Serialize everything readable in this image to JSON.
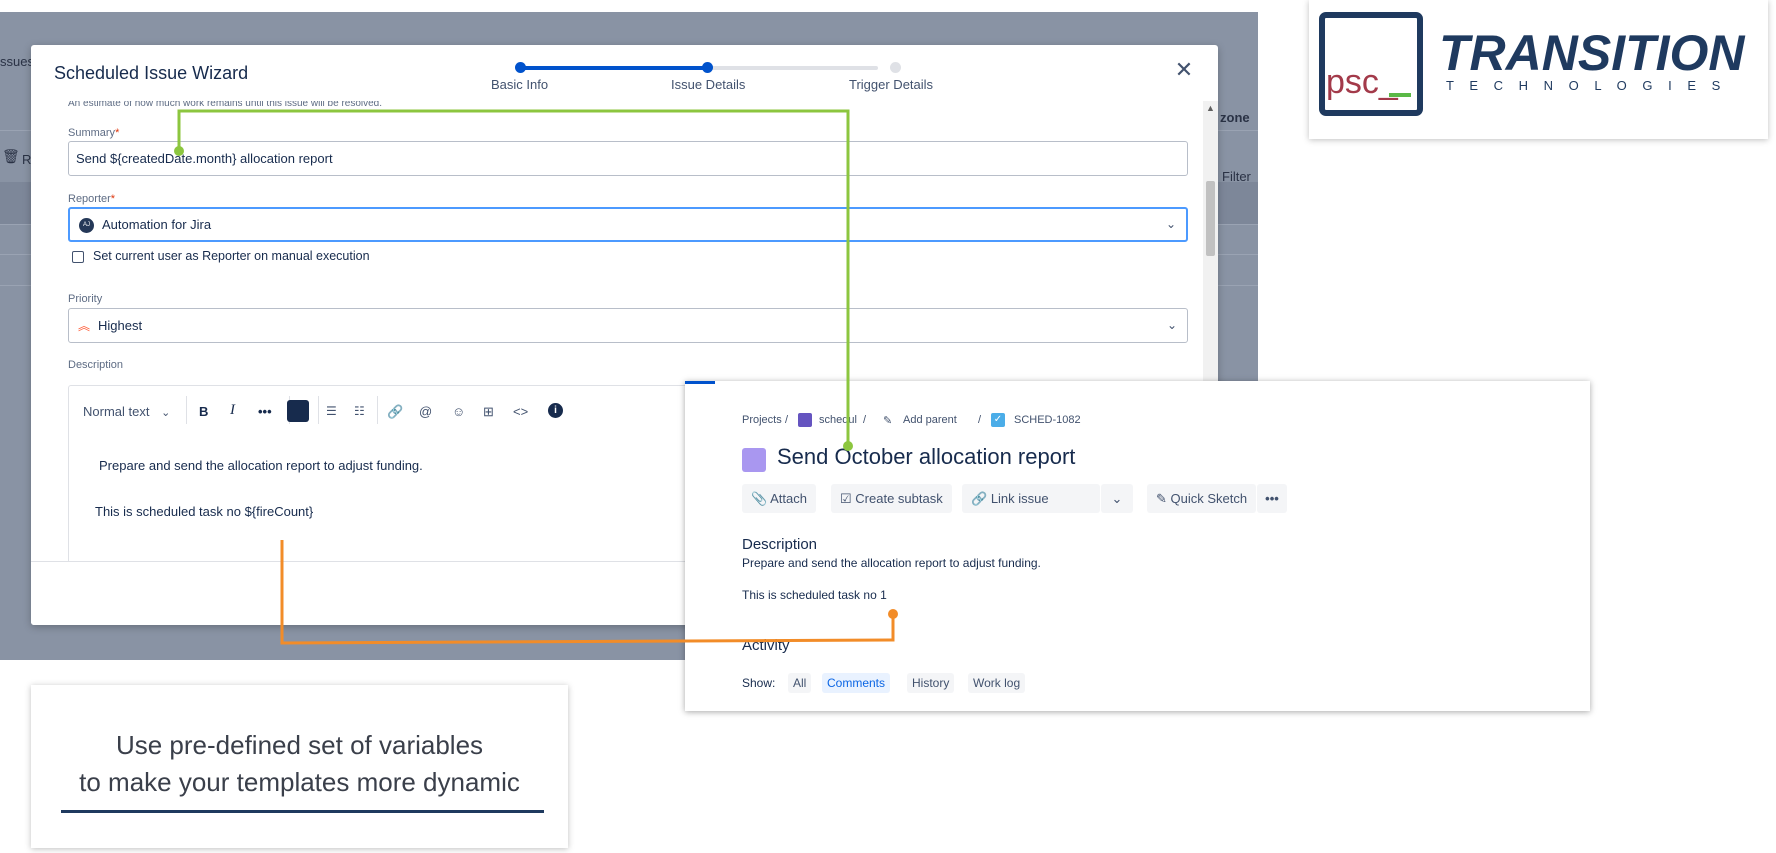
{
  "background": {
    "partial_issues": "ssues",
    "partial_zone": "zone",
    "partial_filter": "Filter",
    "partial_r": "R"
  },
  "wizard": {
    "title": "Scheduled Issue Wizard",
    "steps": [
      {
        "label": "Basic Info"
      },
      {
        "label": "Issue Details"
      },
      {
        "label": "Trigger Details"
      }
    ],
    "accent_color": "#0052cc",
    "truncated_hint": "An estimate of how much work remains until this issue will be resolved.",
    "summary": {
      "label": "Summary",
      "required": "*",
      "value": "Send ${createdDate.month} allocation report"
    },
    "reporter": {
      "label": "Reporter",
      "required": "*",
      "value": "Automation for Jira",
      "avatar": "AJ"
    },
    "reporter_checkbox": "Set current user as Reporter on manual execution",
    "priority": {
      "label": "Priority",
      "value": "Highest",
      "color": "#ff5630"
    },
    "description": {
      "label": "Description",
      "toolbar": {
        "text_style": "Normal text"
      },
      "line1": "Prepare and send the allocation report to adjust funding.",
      "line2": "This is scheduled task no ${fireCount}"
    }
  },
  "issue": {
    "breadcrumb": {
      "projects": "Projects",
      "project": "schedul",
      "add_parent": "Add parent",
      "key": "SCHED-1082"
    },
    "title": "Send October allocation report",
    "actions": {
      "attach": "Attach",
      "create_subtask": "Create subtask",
      "link_issue": "Link issue",
      "quick_sketch": "Quick Sketch"
    },
    "description_heading": "Description",
    "description_line1": "Prepare and send the allocation report to adjust funding.",
    "description_line2": "This is scheduled task no 1",
    "activity_heading": "Activity",
    "show_label": "Show:",
    "filters": [
      "All",
      "Comments",
      "History",
      "Work log"
    ]
  },
  "caption": {
    "line1": "Use pre-defined set of variables",
    "line2": "to make your templates more dynamic"
  },
  "logo": {
    "psc": "psc_",
    "brand": "TRANSITION",
    "tagline": "T E C H N O L O G I E S",
    "navy": "#1f3a5f",
    "psc_color": "#a33a4a",
    "green": "#5ab946"
  },
  "connectors": {
    "summary_line": "#8cc63f",
    "count_line": "#f28c28"
  }
}
